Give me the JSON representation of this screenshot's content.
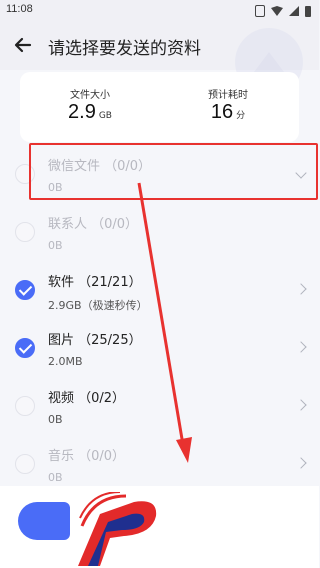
{
  "status": {
    "time": "11:08"
  },
  "header": {
    "title": "请选择要发送的资料"
  },
  "summary": {
    "size_label": "文件大小",
    "size_value": "2.9",
    "size_unit": "GB",
    "time_label": "预计耗时",
    "time_value": "16",
    "time_unit": "分"
  },
  "items": [
    {
      "title": "微信文件 （0/0）",
      "subtitle": "0B",
      "selected": false,
      "disabled": true
    },
    {
      "title": "联系人 （0/0）",
      "subtitle": "0B",
      "selected": false,
      "disabled": true
    },
    {
      "title": "软件 （21/21）",
      "subtitle": "2.9GB（极速秒传）",
      "selected": true,
      "disabled": false
    },
    {
      "title": "图片 （25/25）",
      "subtitle": "2.0MB",
      "selected": true,
      "disabled": false
    },
    {
      "title": "视频 （0/2）",
      "subtitle": "0B",
      "selected": false,
      "disabled": false
    },
    {
      "title": "音乐 （0/0）",
      "subtitle": "0B",
      "selected": false,
      "disabled": true
    }
  ],
  "colors": {
    "accent": "#4a6cf7",
    "annotation": "#e8322f"
  },
  "icons": {
    "back": "arrow-left-icon",
    "expand": "chevron-down-icon",
    "row_chevron": "chevron-right-icon"
  }
}
